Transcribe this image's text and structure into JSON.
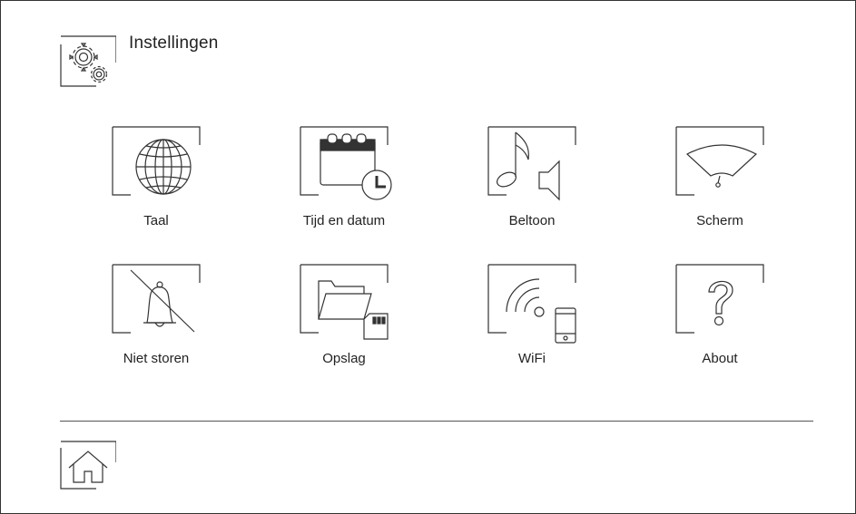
{
  "header": {
    "title": "Instellingen",
    "icon": "settings-gears-icon"
  },
  "menu": {
    "items": [
      {
        "label": "Taal",
        "icon": "globe-icon"
      },
      {
        "label": "Tijd en datum",
        "icon": "calendar-clock-icon"
      },
      {
        "label": "Beltoon",
        "icon": "music-note-speaker-icon"
      },
      {
        "label": "Scherm",
        "icon": "screen-brightness-gauge-icon"
      },
      {
        "label": "Niet storen",
        "icon": "bell-muted-icon"
      },
      {
        "label": "Opslag",
        "icon": "folder-sdcard-icon"
      },
      {
        "label": "WiFi",
        "icon": "wifi-phone-icon"
      },
      {
        "label": "About",
        "icon": "question-mark-icon"
      }
    ]
  },
  "footer": {
    "home_icon": "home-icon"
  },
  "colors": {
    "stroke": "#333333",
    "background": "#ffffff",
    "text": "#222222"
  }
}
